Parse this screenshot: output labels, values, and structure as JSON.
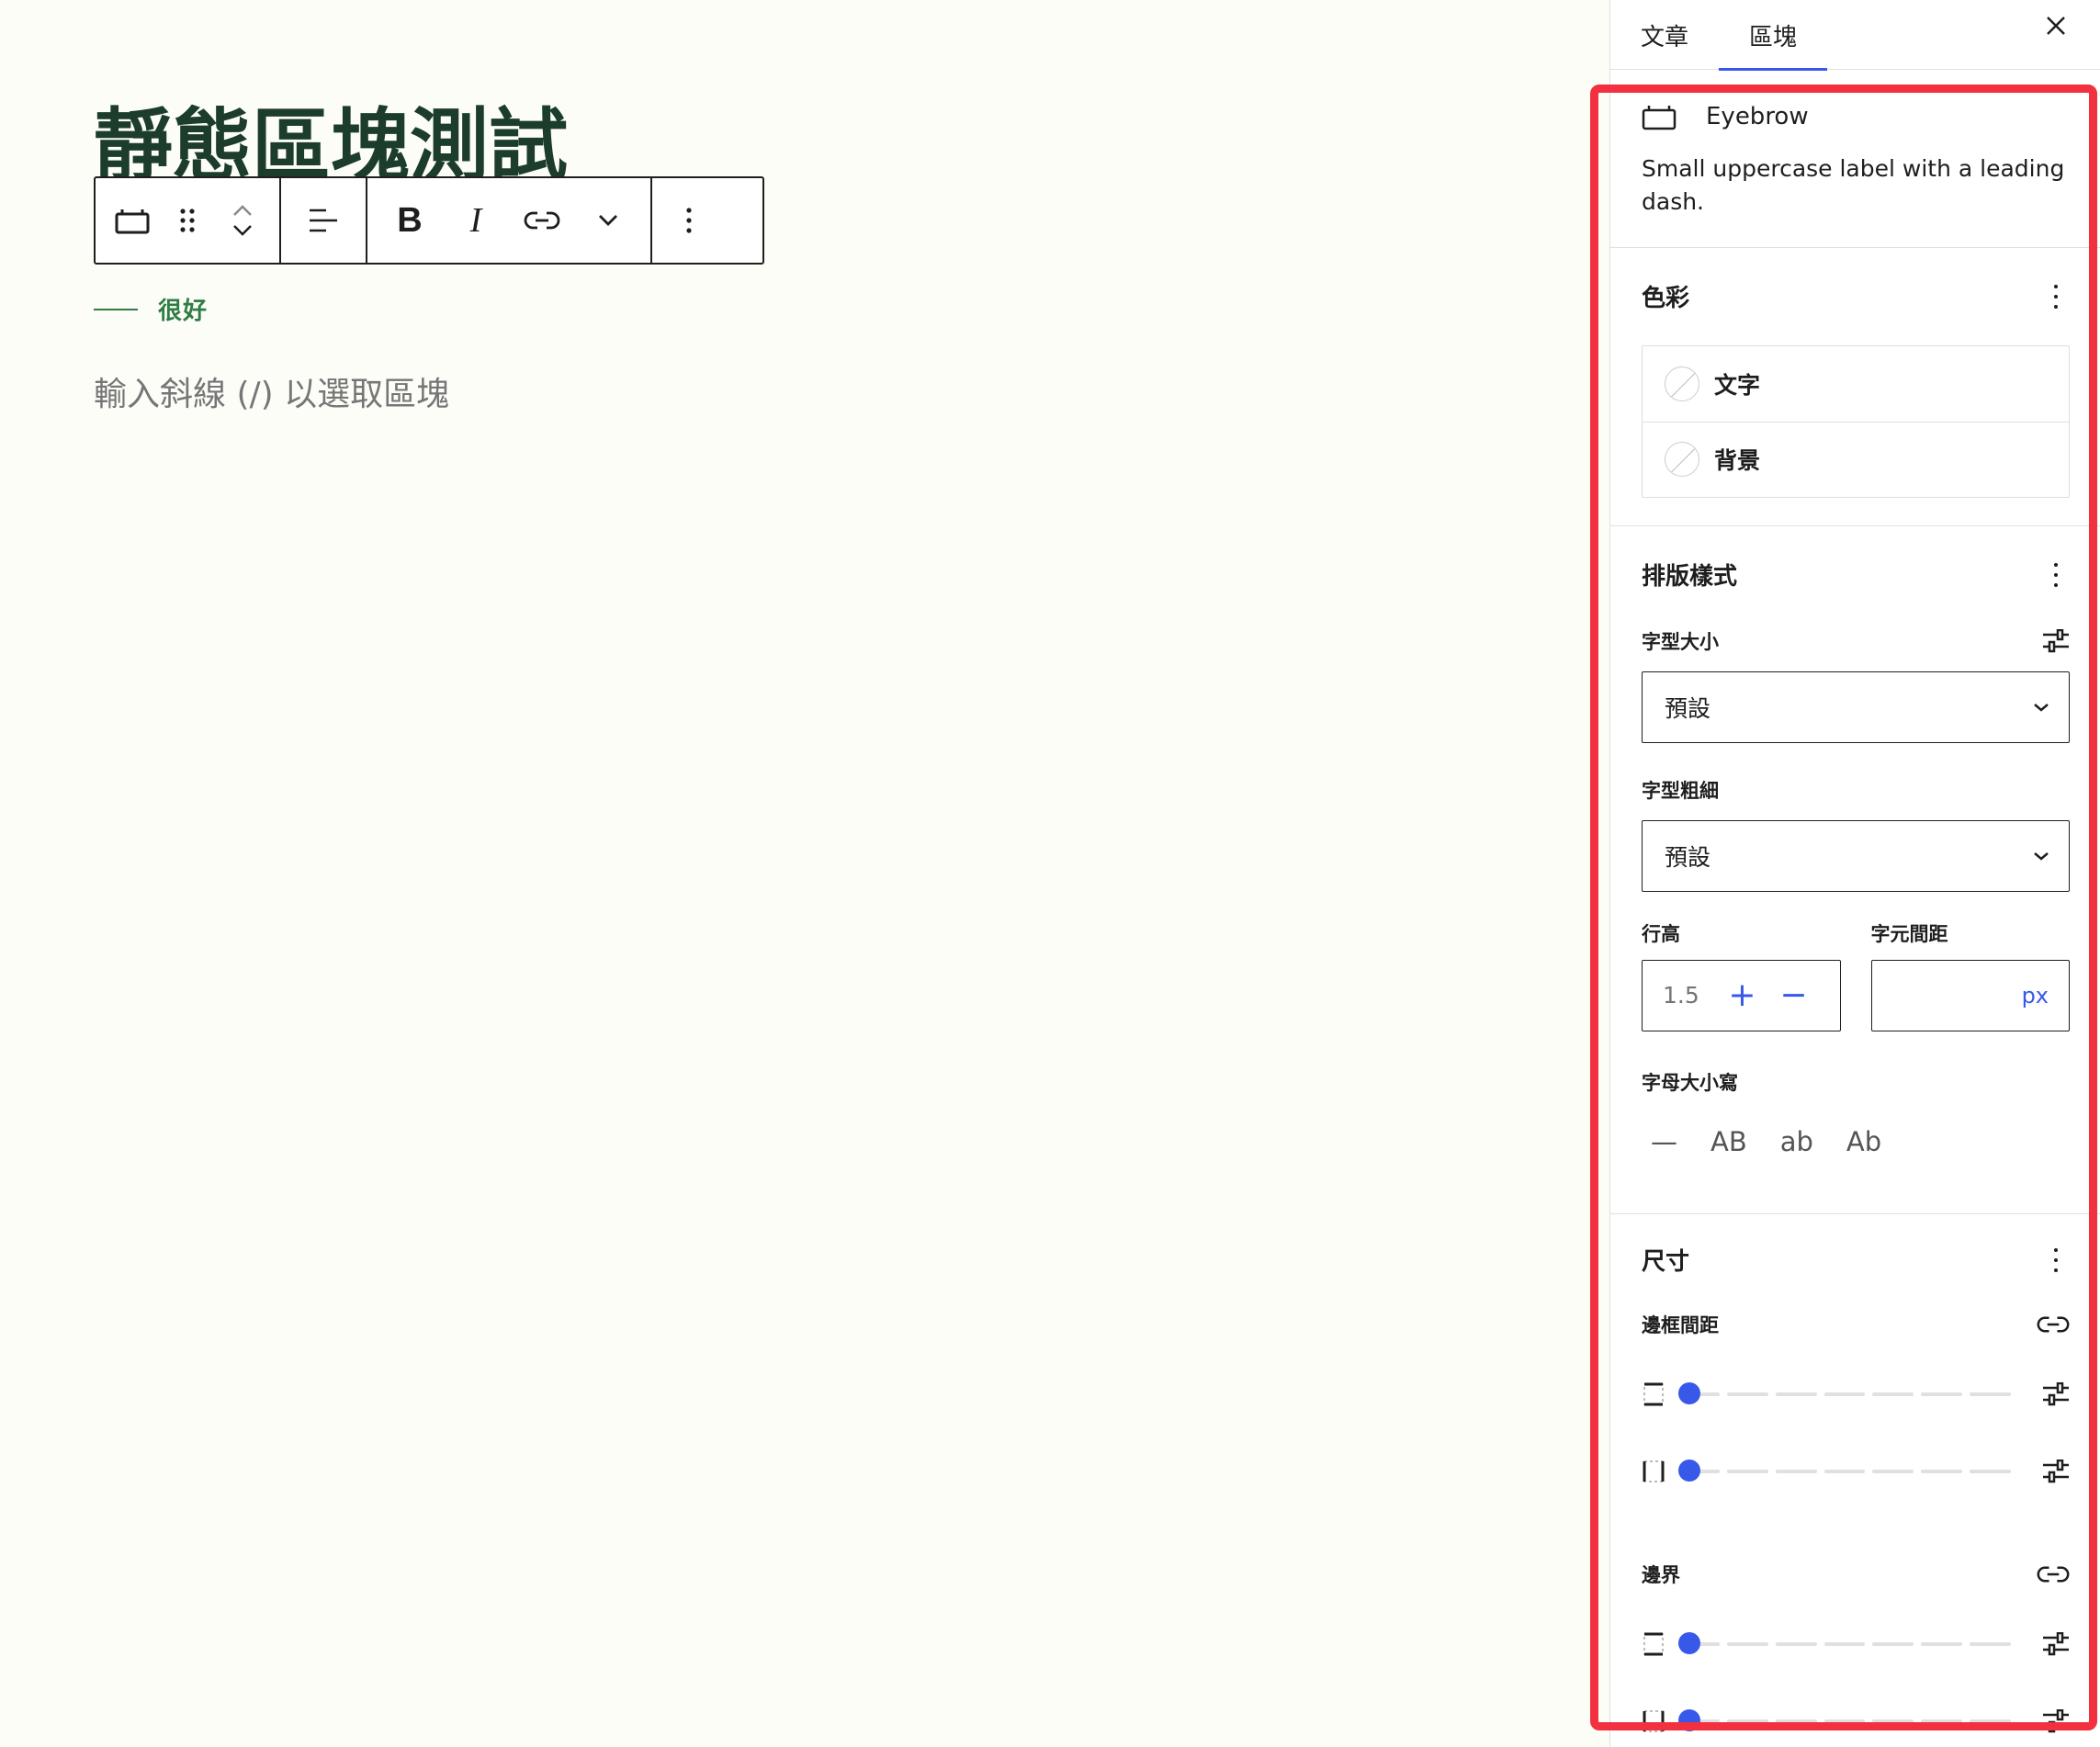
{
  "editor": {
    "post_title": "靜態區塊測試",
    "eyebrow_text": "很好",
    "placeholder": "輸入斜線 (/) 以選取區塊",
    "toolbar": {
      "bold_label": "B",
      "italic_label": "I"
    }
  },
  "sidebar": {
    "tabs": [
      {
        "label": "文章",
        "active": false
      },
      {
        "label": "區塊",
        "active": true
      }
    ],
    "close_label": "×",
    "block_card": {
      "title": "Eyebrow",
      "description": "Small uppercase label with a leading dash."
    },
    "color_section": {
      "title": "色彩",
      "items": [
        {
          "label": "文字"
        },
        {
          "label": "背景"
        }
      ]
    },
    "typography": {
      "title": "排版樣式",
      "font_size_label": "字型大小",
      "font_size_value": "預設",
      "font_weight_label": "字型粗細",
      "font_weight_value": "預設",
      "line_height_label": "行高",
      "line_height_value": "1.5",
      "letter_spacing_label": "字元間距",
      "letter_spacing_unit": "px",
      "letter_case_label": "字母大小寫",
      "letter_case_options": [
        "—",
        "AB",
        "ab",
        "Ab"
      ]
    },
    "dimensions": {
      "title": "尺寸",
      "padding_label": "邊框間距",
      "margin_label": "邊界",
      "slider_values": [
        0,
        0,
        0,
        0
      ]
    }
  },
  "colors": {
    "accent": "#3858e9",
    "title_green": "#1c3d2b",
    "eyebrow_green": "#2f7d46",
    "highlight_red": "#f2303f"
  }
}
